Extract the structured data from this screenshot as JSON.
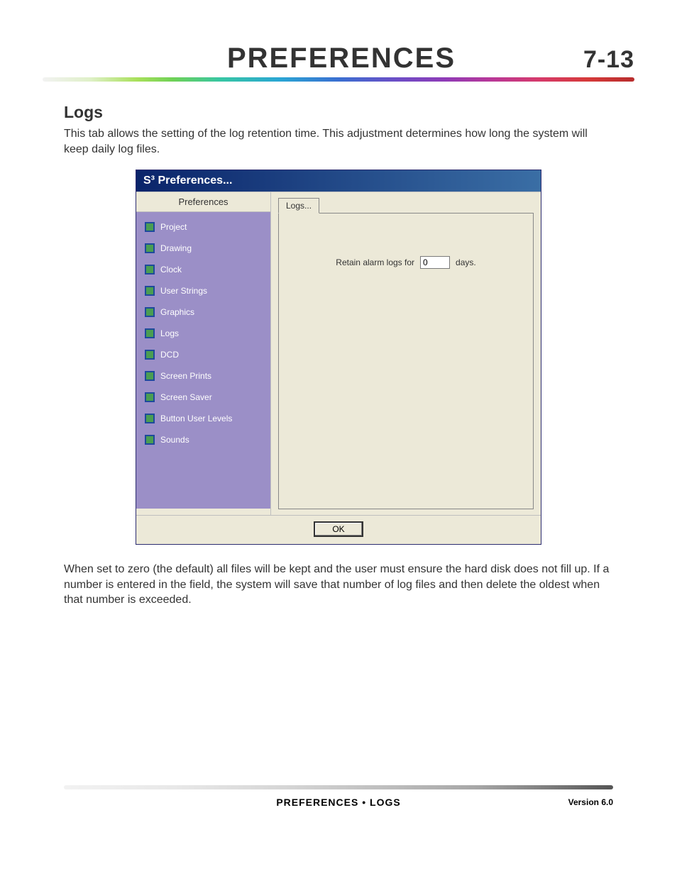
{
  "header": {
    "title": "PREFERENCES",
    "page_number": "7-13"
  },
  "section": {
    "heading": "Logs",
    "intro": "This tab allows the setting of the log retention time.  This adjustment determines how long the system will keep daily log files.",
    "after": "When set to zero (the default) all files will be kept and the user must ensure the hard disk does not fill up.  If a number is entered in the field, the system will save that number of log files and then delete the oldest when that number is exceeded."
  },
  "dialog": {
    "title": "S³ Preferences...",
    "sidebar_header": "Preferences",
    "sidebar_items": [
      "Project",
      "Drawing",
      "Clock",
      "User Strings",
      "Graphics",
      "Logs",
      "DCD",
      "Screen Prints",
      "Screen Saver",
      "Button User Levels",
      "Sounds"
    ],
    "tab_label": "Logs...",
    "field_prefix": "Retain alarm logs for",
    "field_value": "0",
    "field_suffix": "days.",
    "ok_label": "OK"
  },
  "footer": {
    "center": "PREFERENCES • LOGS",
    "right": "Version 6.0"
  }
}
